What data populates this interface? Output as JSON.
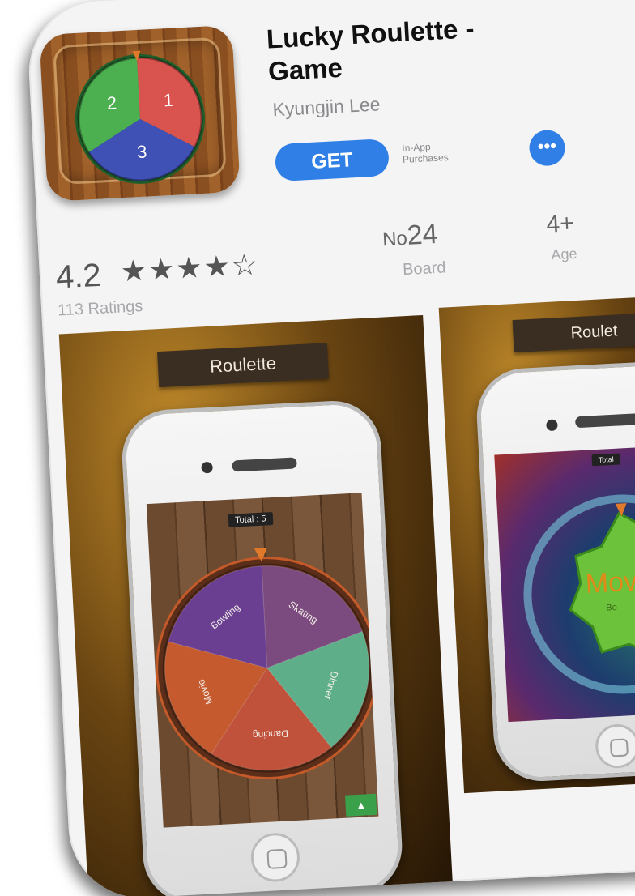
{
  "app": {
    "title": "Lucky Roulette - Game",
    "developer": "Kyungjin Lee",
    "get_label": "GET",
    "iap_line1": "In-App",
    "iap_line2": "Purchases",
    "more_label": "•••",
    "icon_wheel_labels": [
      "2",
      "1",
      "3"
    ],
    "icon_wheel_colors": [
      "#4caf50",
      "#d9534f",
      "#3f51b5"
    ]
  },
  "info": {
    "rating": "4.2",
    "stars": "★★★★☆",
    "rating_fraction": 0.84,
    "ratings_count": "113 Ratings",
    "chart_prefix": "No",
    "chart_rank": "24",
    "chart_category": "Board",
    "age": "4+",
    "age_label": "Age"
  },
  "screenshots": [
    {
      "banner": "Roulette",
      "total": "Total : 5",
      "up_icon": "▲",
      "segments": [
        {
          "label": "Skating",
          "color": "#7b4a7e"
        },
        {
          "label": "Dinner",
          "color": "#5fae8a"
        },
        {
          "label": "Dancing",
          "color": "#c0513a"
        },
        {
          "label": "Movie",
          "color": "#c55a2e"
        },
        {
          "label": "Bowling",
          "color": "#6a3f92"
        }
      ]
    },
    {
      "banner": "Roulet",
      "total": "Total",
      "center_label": "Mov",
      "center_sub": "Bo"
    }
  ]
}
